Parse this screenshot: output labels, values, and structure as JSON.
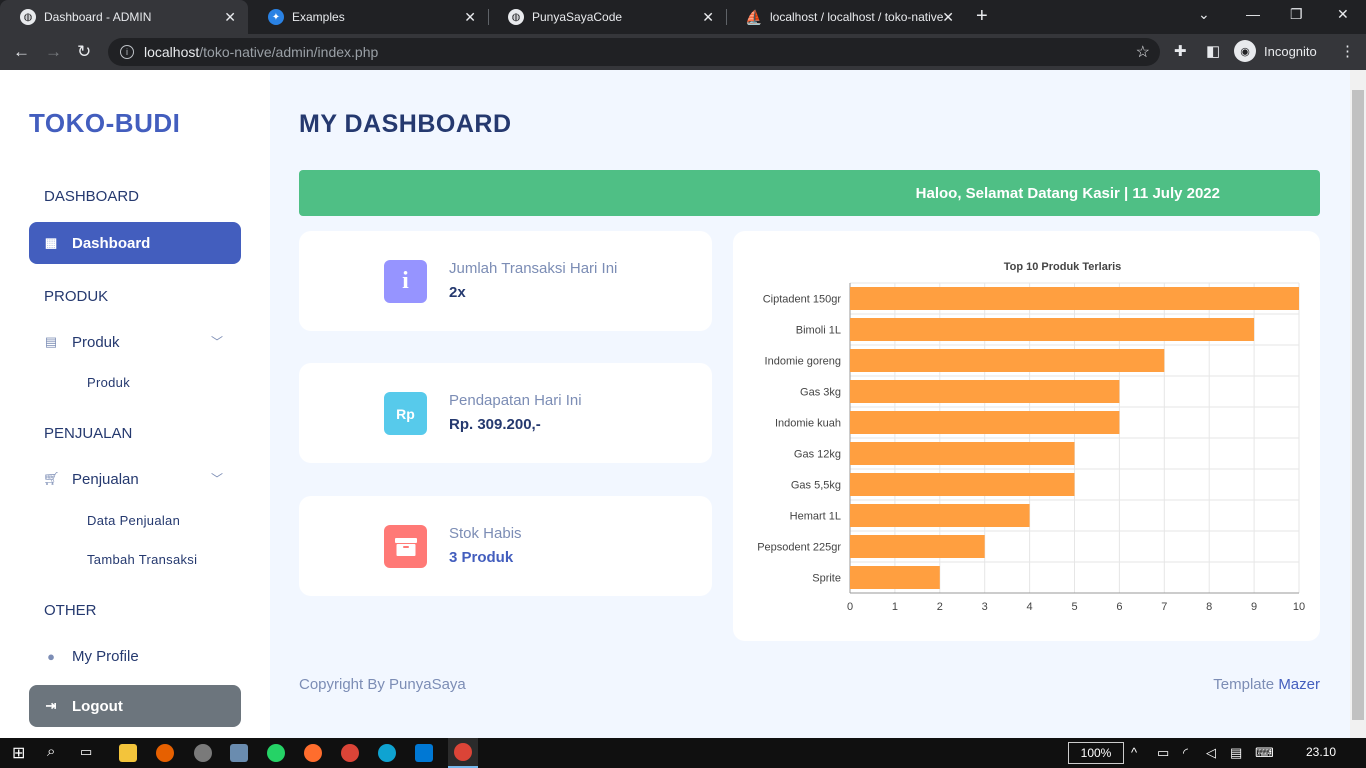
{
  "browser": {
    "tabs": [
      {
        "title": "Dashboard - ADMIN",
        "active": true
      },
      {
        "title": "Examples",
        "active": false
      },
      {
        "title": "PunyaSayaCode",
        "active": false
      },
      {
        "title": "localhost / localhost / toko-native",
        "active": false
      }
    ],
    "url_host": "localhost",
    "url_path": "/toko-native/admin/index.php",
    "profile_label": "Incognito"
  },
  "sidebar": {
    "brand": "TOKO-BUDI",
    "sections": {
      "dashboard": "DASHBOARD",
      "produk": "PRODUK",
      "penjualan": "PENJUALAN",
      "other": "OTHER"
    },
    "items": {
      "dashboard": "Dashboard",
      "produk": "Produk",
      "produk_sub": "Produk",
      "penjualan": "Penjualan",
      "data_penjualan": "Data Penjualan",
      "tambah_transaksi": "Tambah Transaksi",
      "my_profile": "My Profile",
      "logout": "Logout"
    }
  },
  "main": {
    "title": "MY DASHBOARD",
    "banner": "Haloo, Selamat Datang Kasir | 11 July 2022",
    "stats": [
      {
        "label": "Jumlah Transaksi Hari Ini",
        "value": "2x",
        "icon": "i",
        "color": "#9694ff"
      },
      {
        "label": "Pendapatan Hari Ini",
        "value": "Rp. 309.200,-",
        "icon": "Rp",
        "color": "#57caeb"
      },
      {
        "label": "Stok Habis",
        "value": "3 Produk",
        "icon": "box",
        "color": "#ff7976"
      }
    ],
    "footer": {
      "left": "Copyright By PunyaSaya",
      "right_prefix": "Template ",
      "right_link": "Mazer"
    }
  },
  "chart_data": {
    "type": "bar",
    "orientation": "horizontal",
    "title": "Top 10 Produk Terlaris",
    "categories": [
      "Ciptadent 150gr",
      "Bimoli 1L",
      "Indomie goreng",
      "Gas 3kg",
      "Indomie kuah",
      "Gas 12kg",
      "Gas 5,5kg",
      "Hemart 1L",
      "Pepsodent 225gr",
      "Sprite"
    ],
    "values": [
      10,
      9,
      7,
      6,
      6,
      5,
      5,
      4,
      3,
      2
    ],
    "xlim": [
      0,
      10
    ],
    "xticks": [
      0,
      1,
      2,
      3,
      4,
      5,
      6,
      7,
      8,
      9,
      10
    ],
    "grid": true,
    "bar_color": "#ff9f40"
  },
  "taskbar": {
    "zoom": "100%",
    "time": "23.10"
  }
}
